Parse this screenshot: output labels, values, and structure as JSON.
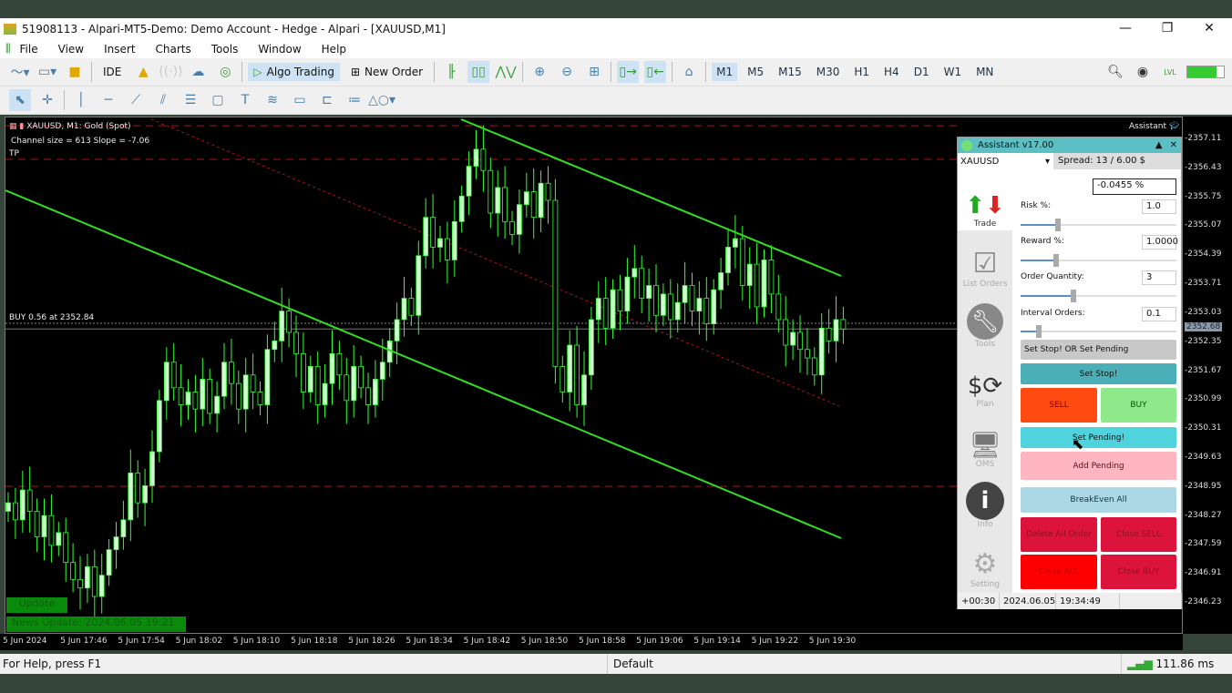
{
  "window": {
    "title": "51908113 - Alpari-MT5-Demo: Demo Account - Hedge - Alpari - [XAUUSD,M1]",
    "minimize": "—",
    "restore": "❐",
    "close": "✕"
  },
  "menu": [
    "File",
    "View",
    "Insert",
    "Charts",
    "Tools",
    "Window",
    "Help"
  ],
  "toolbar": {
    "ide": "IDE",
    "algo_trading": "Algo Trading",
    "new_order": "New Order",
    "timeframes": [
      "M1",
      "M5",
      "M15",
      "M30",
      "H1",
      "H4",
      "D1",
      "W1",
      "MN"
    ],
    "active_timeframe": "M1",
    "lvl": "LVL"
  },
  "chart": {
    "symbol_title": "XAUUSD, M1:  Gold (Spot)",
    "channel_info": "Channel size = 613 Slope = -7.06",
    "tp_label": "TP",
    "buy_label": "BUY 0.56 at 2352.84",
    "assistant_label": "Assistant",
    "update_button": "Update",
    "news_update": "News Update: 2024.06.05 19:21",
    "price_labels": [
      "2357.11",
      "2356.43",
      "2355.75",
      "2355.07",
      "2354.39",
      "2353.71",
      "2353.03",
      "2352.35",
      "2351.67",
      "2350.99",
      "2350.31",
      "2349.63",
      "2348.95",
      "2348.27",
      "2347.59",
      "2346.91",
      "2346.23"
    ],
    "current_price": "2352.68",
    "time_labels": [
      "5 Jun 2024",
      "5 Jun 17:46",
      "5 Jun 17:54",
      "5 Jun 18:02",
      "5 Jun 18:10",
      "5 Jun 18:18",
      "5 Jun 18:26",
      "5 Jun 18:34",
      "5 Jun 18:42",
      "5 Jun 18:50",
      "5 Jun 18:58",
      "5 Jun 19:06",
      "5 Jun 19:14",
      "5 Jun 19:22",
      "5 Jun 19:30"
    ],
    "open": 2348.4,
    "closes": [
      2348.6,
      2348.2,
      2348.9,
      2348.4,
      2347.8,
      2348.3,
      2347.6,
      2347.9,
      2347.2,
      2346.8,
      2346.6,
      2347.1,
      2346.4,
      2346.9,
      2347.5,
      2347.8,
      2348.2,
      2349.3,
      2348.6,
      2349.0,
      2349.8,
      2351.0,
      2351.9,
      2351.3,
      2350.9,
      2351.2,
      2350.8,
      2351.5,
      2350.7,
      2351.1,
      2351.9,
      2351.4,
      2350.8,
      2351.6,
      2351.2,
      2350.9,
      2352.2,
      2352.4,
      2353.1,
      2352.6,
      2352.1,
      2351.2,
      2351.8,
      2350.9,
      2351.4,
      2352.1,
      2351.6,
      2351.0,
      2351.8,
      2351.3,
      2350.9,
      2351.5,
      2351.9,
      2352.4,
      2352.9,
      2353.4,
      2353.0,
      2354.4,
      2355.3,
      2354.6,
      2354.8,
      2354.3,
      2355.2,
      2355.8,
      2356.5,
      2356.9,
      2356.4,
      2355.4,
      2356.0,
      2355.2,
      2354.9,
      2355.6,
      2355.9,
      2355.3,
      2356.1,
      2355.7,
      2351.8,
      2351.2,
      2352.3,
      2350.9,
      2351.6,
      2352.9,
      2353.4,
      2352.7,
      2353.6,
      2353.1,
      2353.9,
      2354.1,
      2353.4,
      2353.7,
      2353.0,
      2353.5,
      2352.9,
      2353.3,
      2353.7,
      2353.1,
      2353.4,
      2352.8,
      2353.6,
      2354.0,
      2354.6,
      2354.8,
      2353.7,
      2354.2,
      2353.2,
      2354.3,
      2353.5,
      2352.9,
      2352.3,
      2352.6,
      2352.2,
      2352.0,
      2351.6,
      2352.7,
      2352.4,
      2352.9,
      2352.68
    ],
    "colors": {
      "up": "#ccffcc",
      "down": "#000000",
      "wick": "#33ff33",
      "channel": "#33dd22",
      "level": "#b01020"
    }
  },
  "assistant": {
    "title": "Assistant v17.00",
    "symbol": "XAUUSD",
    "spread": "Spread: 13 / 6.00 $",
    "pct": "-0.0455 %",
    "risk_label": "Risk %:",
    "risk": "1.0",
    "risk_slider": 0.22,
    "reward_label": "Reward %:",
    "reward": "1.0000",
    "reward_slider": 0.21,
    "qty_label": "Order Quantity:",
    "qty": "3",
    "qty_slider": 0.32,
    "interval_label": "Interval Orders:",
    "interval": "0.1",
    "interval_slider": 0.1,
    "tabs": [
      "Trade",
      "List Orders",
      "Tools",
      "Plan",
      "OMS",
      "Info",
      "Setting"
    ],
    "buttons": {
      "set_stop_or_pending": "Set Stop! OR Set Pending",
      "set_stop": "Set Stop!",
      "sell": "SELL",
      "buy": "BUY",
      "set_pending": "Set Pending!",
      "add_pending": "Add Pending",
      "breakeven": "BreakEven All",
      "delete_all": "Delete All Order",
      "close_sell": "Close SELL",
      "close_all": "Close ALL",
      "close_buy": "Close BUY"
    },
    "footer": {
      "offset": "+00:30",
      "date": "2024.06.05",
      "time": "19:34:49"
    }
  },
  "status": {
    "help": "For Help, press F1",
    "profile": "Default",
    "ping": "111.86 ms"
  }
}
